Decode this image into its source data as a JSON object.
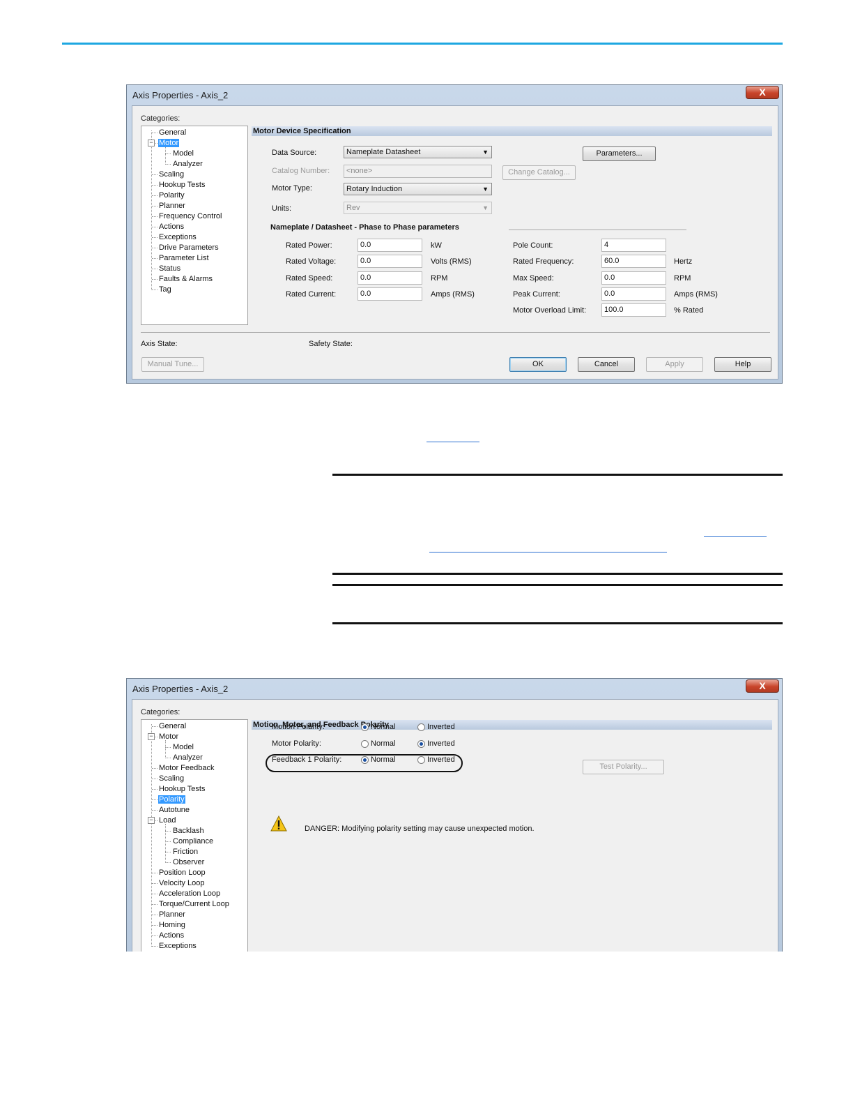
{
  "dialog1": {
    "title": "Axis Properties - Axis_2",
    "close_label": "X",
    "categories_label": "Categories:",
    "tree": [
      {
        "label": "General"
      },
      {
        "label": "Motor",
        "selected": true,
        "expanded": true
      },
      {
        "label": "Model"
      },
      {
        "label": "Analyzer"
      },
      {
        "label": "Scaling"
      },
      {
        "label": "Hookup Tests"
      },
      {
        "label": "Polarity"
      },
      {
        "label": "Planner"
      },
      {
        "label": "Frequency Control"
      },
      {
        "label": "Actions"
      },
      {
        "label": "Exceptions"
      },
      {
        "label": "Drive Parameters"
      },
      {
        "label": "Parameter List"
      },
      {
        "label": "Status"
      },
      {
        "label": "Faults & Alarms"
      },
      {
        "label": "Tag"
      }
    ],
    "section_title": "Motor Device Specification",
    "data_source_label": "Data Source:",
    "data_source_value": "Nameplate Datasheet",
    "parameters_button": "Parameters...",
    "catalog_label": "Catalog Number:",
    "catalog_value": "<none>",
    "change_catalog_button": "Change Catalog...",
    "motor_type_label": "Motor Type:",
    "motor_type_value": "Rotary Induction",
    "units_label": "Units:",
    "units_value": "Rev",
    "nameplate_title": "Nameplate / Datasheet - Phase to Phase parameters",
    "left_fields": [
      {
        "label": "Rated Power:",
        "value": "0.0",
        "unit": "kW"
      },
      {
        "label": "Rated Voltage:",
        "value": "0.0",
        "unit": "Volts (RMS)"
      },
      {
        "label": "Rated Speed:",
        "value": "0.0",
        "unit": "RPM"
      },
      {
        "label": "Rated Current:",
        "value": "0.0",
        "unit": "Amps (RMS)"
      }
    ],
    "right_fields": [
      {
        "label": "Pole Count:",
        "value": "4",
        "unit": ""
      },
      {
        "label": "Rated Frequency:",
        "value": "60.0",
        "unit": "Hertz"
      },
      {
        "label": "Max Speed:",
        "value": "0.0",
        "unit": "RPM"
      },
      {
        "label": "Peak Current:",
        "value": "0.0",
        "unit": "Amps (RMS)"
      },
      {
        "label": "Motor Overload Limit:",
        "value": "100.0",
        "unit": "% Rated"
      }
    ],
    "axis_state_label": "Axis State:",
    "safety_state_label": "Safety State:",
    "manual_tune_button": "Manual Tune...",
    "ok_button": "OK",
    "cancel_button": "Cancel",
    "apply_button": "Apply",
    "help_button": "Help"
  },
  "dialog2": {
    "title": "Axis Properties - Axis_2",
    "close_label": "X",
    "categories_label": "Categories:",
    "tree": [
      {
        "label": "General"
      },
      {
        "label": "Motor",
        "expanded": true
      },
      {
        "label": "Model"
      },
      {
        "label": "Analyzer"
      },
      {
        "label": "Motor Feedback"
      },
      {
        "label": "Scaling"
      },
      {
        "label": "Hookup Tests"
      },
      {
        "label": "Polarity",
        "selected": true
      },
      {
        "label": "Autotune"
      },
      {
        "label": "Load",
        "expanded": true
      },
      {
        "label": "Backlash"
      },
      {
        "label": "Compliance"
      },
      {
        "label": "Friction"
      },
      {
        "label": "Observer"
      },
      {
        "label": "Position Loop"
      },
      {
        "label": "Velocity Loop"
      },
      {
        "label": "Acceleration Loop"
      },
      {
        "label": "Torque/Current Loop"
      },
      {
        "label": "Planner"
      },
      {
        "label": "Homing"
      },
      {
        "label": "Actions"
      },
      {
        "label": "Exceptions"
      }
    ],
    "section_title": "Motion, Motor, and Feedback Polarity",
    "polarity_rows": [
      {
        "label": "Motion Polarity:",
        "normal": "Normal",
        "inverted": "Inverted",
        "selected": "normal"
      },
      {
        "label": "Motor Polarity:",
        "normal": "Normal",
        "inverted": "Inverted",
        "selected": "inverted"
      },
      {
        "label": "Feedback 1 Polarity:",
        "normal": "Normal",
        "inverted": "Inverted",
        "selected": "normal"
      }
    ],
    "test_polarity_button": "Test Polarity...",
    "danger_text": "DANGER: Modifying polarity setting may cause unexpected motion.",
    "warning_icon": "warning-triangle-icon"
  }
}
